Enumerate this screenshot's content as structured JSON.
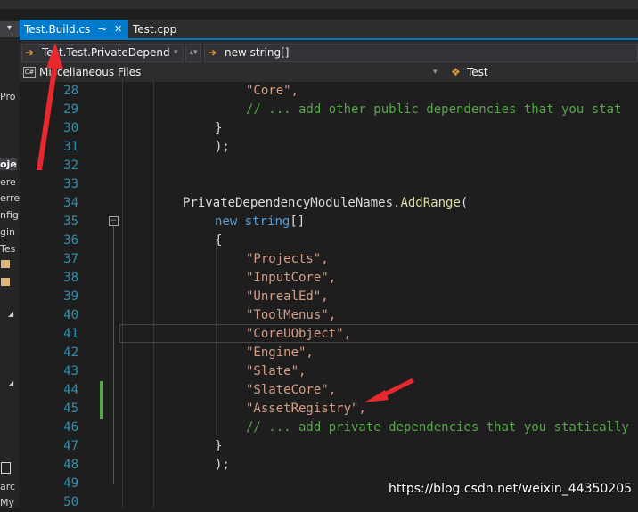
{
  "tabs": [
    {
      "label": "Test.Build.cs",
      "pin_glyph": "⊸",
      "close_glyph": "✕"
    },
    {
      "label": "Test.cpp"
    }
  ],
  "nav": {
    "left_value": "Test.Test.PrivateDepende",
    "right_value": "new string[]",
    "project_label": "Miscellaneous Files",
    "member_label": "Test"
  },
  "left_panel": {
    "fragments": [
      "Pro",
      "oje",
      "ere",
      "erre",
      "nfig",
      "gin",
      "Tes",
      "arc",
      "My"
    ]
  },
  "code_lines": [
    {
      "n": "28",
      "text": "\"Core\","
    },
    {
      "n": "29",
      "text": "// ... add other public dependencies that you stat"
    },
    {
      "n": "30",
      "text": "}"
    },
    {
      "n": "31",
      "text": ");"
    },
    {
      "n": "32",
      "text": ""
    },
    {
      "n": "33",
      "text": ""
    },
    {
      "n": "34",
      "text_a": "PrivateDependencyModuleNames.",
      "text_b": "AddRange",
      "text_c": "("
    },
    {
      "n": "35",
      "text_a": "new",
      "text_b": " string",
      "text_c": "[]"
    },
    {
      "n": "36",
      "text": "{"
    },
    {
      "n": "37",
      "text": "\"Projects\","
    },
    {
      "n": "38",
      "text": "\"InputCore\","
    },
    {
      "n": "39",
      "text": "\"UnrealEd\","
    },
    {
      "n": "40",
      "text": "\"ToolMenus\","
    },
    {
      "n": "41",
      "text": "\"CoreUObject\","
    },
    {
      "n": "42",
      "text": "\"Engine\","
    },
    {
      "n": "43",
      "text": "\"Slate\","
    },
    {
      "n": "44",
      "text": "\"SlateCore\","
    },
    {
      "n": "45",
      "text": "\"AssetRegistry\","
    },
    {
      "n": "46",
      "text": "// ... add private dependencies that you statically"
    },
    {
      "n": "47",
      "text": "}"
    },
    {
      "n": "48",
      "text": ");"
    },
    {
      "n": "49",
      "text": ""
    },
    {
      "n": "50",
      "text": ""
    }
  ],
  "watermark": "https://blog.csdn.net/weixin_44350205",
  "colors": {
    "accent": "#007acc",
    "annotation_arrow": "#e8282e",
    "string": "#d69d85",
    "comment": "#57a64a",
    "keyword": "#569cd6",
    "line_number": "#2b91af"
  }
}
